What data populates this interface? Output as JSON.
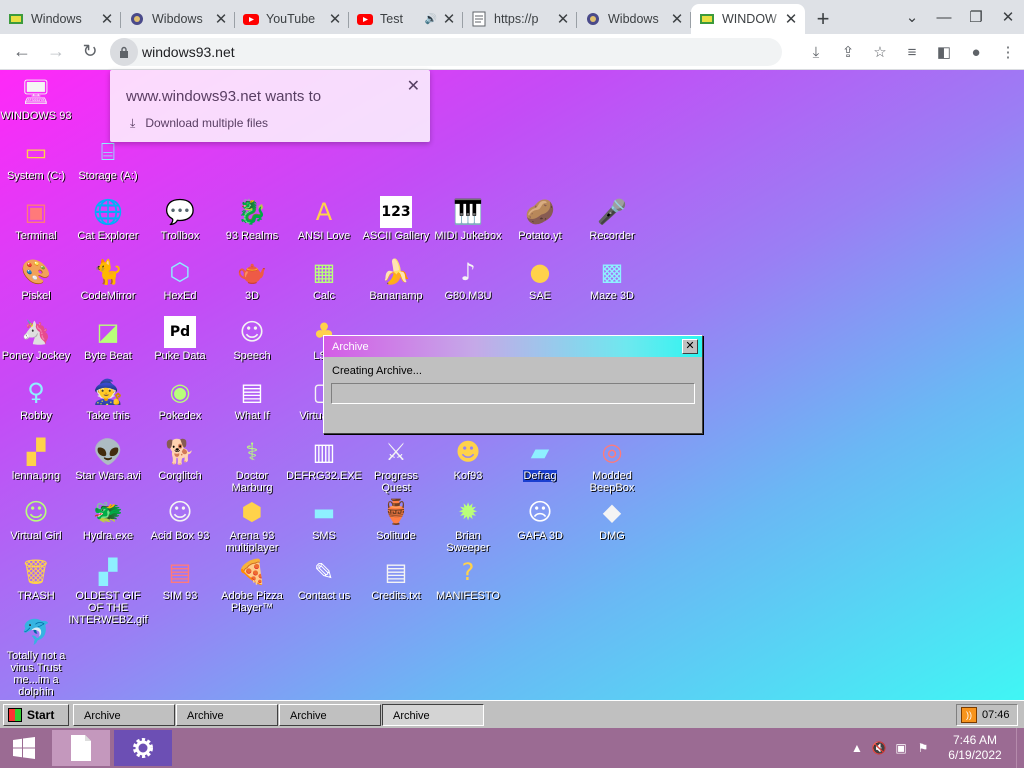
{
  "browser": {
    "tabs": [
      {
        "label": "Windows",
        "icon": "windows93-icon",
        "active": false,
        "audio": false
      },
      {
        "label": "Wibdows",
        "icon": "wibdows-icon",
        "active": false,
        "audio": false
      },
      {
        "label": "YouTube",
        "icon": "youtube-icon",
        "active": false,
        "audio": false
      },
      {
        "label": "Test",
        "icon": "youtube-icon",
        "active": false,
        "audio": true
      },
      {
        "label": "https://p",
        "icon": "page-icon",
        "active": false,
        "audio": false
      },
      {
        "label": "Wibdows",
        "icon": "wibdows-icon",
        "active": false,
        "audio": false
      },
      {
        "label": "WINDOW",
        "icon": "windows93-icon",
        "active": true,
        "audio": false
      }
    ],
    "url": "windows93.net"
  },
  "download_prompt": {
    "title": "www.windows93.net wants to",
    "request": "Download multiple files"
  },
  "desktop": {
    "icons": [
      {
        "label": "WINDOWS 93",
        "glyph": "🖥",
        "col": 0,
        "row": 0
      },
      {
        "label": "System (C:)",
        "glyph": "▭",
        "col": 0,
        "row": 1
      },
      {
        "label": "Storage (A:)",
        "glyph": "⌸",
        "col": 1,
        "row": 1
      },
      {
        "label": "Terminal",
        "glyph": "▣",
        "col": 0,
        "row": 2
      },
      {
        "label": "Cat Explorer",
        "glyph": "🌐",
        "col": 1,
        "row": 2
      },
      {
        "label": "Trollbox",
        "glyph": "💬",
        "col": 2,
        "row": 2
      },
      {
        "label": "93 Realms",
        "glyph": "🐉",
        "col": 3,
        "row": 2
      },
      {
        "label": "ANSI Love",
        "glyph": "A",
        "col": 4,
        "row": 2
      },
      {
        "label": "ASCII Gallery",
        "glyph": "123",
        "col": 5,
        "row": 2
      },
      {
        "label": "MIDI Jukebox",
        "glyph": "🎹",
        "col": 6,
        "row": 2
      },
      {
        "label": "Potato.yt",
        "glyph": "🥔",
        "col": 7,
        "row": 2
      },
      {
        "label": "Recorder",
        "glyph": "🎤",
        "col": 8,
        "row": 2
      },
      {
        "label": "Piskel",
        "glyph": "🎨",
        "col": 0,
        "row": 3
      },
      {
        "label": "CodeMirror",
        "glyph": "🐈",
        "col": 1,
        "row": 3
      },
      {
        "label": "HexEd",
        "glyph": "⬡",
        "col": 2,
        "row": 3
      },
      {
        "label": "3D",
        "glyph": "🫖",
        "col": 3,
        "row": 3
      },
      {
        "label": "Calc",
        "glyph": "▦",
        "col": 4,
        "row": 3
      },
      {
        "label": "Bananamp",
        "glyph": "🍌",
        "col": 5,
        "row": 3
      },
      {
        "label": "G80.M3U",
        "glyph": "♪",
        "col": 6,
        "row": 3
      },
      {
        "label": "SAE",
        "glyph": "●",
        "col": 7,
        "row": 3
      },
      {
        "label": "Maze 3D",
        "glyph": "▩",
        "col": 8,
        "row": 3
      },
      {
        "label": "Poney Jockey",
        "glyph": "🦄",
        "col": 0,
        "row": 4
      },
      {
        "label": "Byte Beat",
        "glyph": "◪",
        "col": 1,
        "row": 4
      },
      {
        "label": "Puke Data",
        "glyph": "Pd",
        "col": 2,
        "row": 4
      },
      {
        "label": "Speech",
        "glyph": "☺",
        "col": 3,
        "row": 4
      },
      {
        "label": "LSD",
        "glyph": "♣",
        "col": 4,
        "row": 4
      },
      {
        "label": "Robby",
        "glyph": "♀",
        "col": 0,
        "row": 5
      },
      {
        "label": "Take this",
        "glyph": "🧙",
        "col": 1,
        "row": 5
      },
      {
        "label": "Pokedex",
        "glyph": "◉",
        "col": 2,
        "row": 5
      },
      {
        "label": "What If",
        "glyph": "▤",
        "col": 3,
        "row": 5
      },
      {
        "label": "Virtual PC",
        "glyph": "▢",
        "col": 4,
        "row": 5
      },
      {
        "label": "lenna.png",
        "glyph": "▞",
        "col": 0,
        "row": 6
      },
      {
        "label": "Star Wars.avi",
        "glyph": "👽",
        "col": 1,
        "row": 6
      },
      {
        "label": "Corglitch",
        "glyph": "🐕",
        "col": 2,
        "row": 6
      },
      {
        "label": "Doctor Marburg",
        "glyph": "⚕",
        "col": 3,
        "row": 6
      },
      {
        "label": "DEFRG32.EXE",
        "glyph": "▥",
        "col": 4,
        "row": 6
      },
      {
        "label": "Progress Quest",
        "glyph": "⚔",
        "col": 5,
        "row": 6
      },
      {
        "label": "Kof93",
        "glyph": "☻",
        "col": 6,
        "row": 6
      },
      {
        "label": "Defrag",
        "glyph": "▰",
        "col": 7,
        "row": 6,
        "selected": true
      },
      {
        "label": "Modded BeepBox",
        "glyph": "◎",
        "col": 8,
        "row": 6
      },
      {
        "label": "Virtual Girl",
        "glyph": "☺",
        "col": 0,
        "row": 7
      },
      {
        "label": "Hydra.exe",
        "glyph": "🐲",
        "col": 1,
        "row": 7
      },
      {
        "label": "Acid Box 93",
        "glyph": "☺",
        "col": 2,
        "row": 7
      },
      {
        "label": "Arena 93 multiplayer",
        "glyph": "⬢",
        "col": 3,
        "row": 7
      },
      {
        "label": "SMS",
        "glyph": "▬",
        "col": 4,
        "row": 7
      },
      {
        "label": "Solitude",
        "glyph": "🏺",
        "col": 5,
        "row": 7
      },
      {
        "label": "Brian Sweeper",
        "glyph": "✹",
        "col": 6,
        "row": 7
      },
      {
        "label": "GAFA 3D",
        "glyph": "☹",
        "col": 7,
        "row": 7
      },
      {
        "label": "DMG",
        "glyph": "◆",
        "col": 8,
        "row": 7
      },
      {
        "label": "TRASH",
        "glyph": "🗑",
        "col": 0,
        "row": 8
      },
      {
        "label": "OLDEST GIF OF THE INTERWEBZ.gif",
        "glyph": "▞",
        "col": 1,
        "row": 8
      },
      {
        "label": "SIM 93",
        "glyph": "▤",
        "col": 2,
        "row": 8
      },
      {
        "label": "Adobe Pizza Player™",
        "glyph": "🍕",
        "col": 3,
        "row": 8
      },
      {
        "label": "Contact us",
        "glyph": "✎",
        "col": 4,
        "row": 8
      },
      {
        "label": "Credits.txt",
        "glyph": "▤",
        "col": 5,
        "row": 8
      },
      {
        "label": "MANIFESTO",
        "glyph": "?",
        "col": 6,
        "row": 8
      },
      {
        "label": "Totally not a virus.Trust me...im a dolphin",
        "glyph": "🐬",
        "col": 0,
        "row": 9
      }
    ]
  },
  "archive_dialog": {
    "title": "Archive",
    "message": "Creating Archive...",
    "progress": 0
  },
  "win93_taskbar": {
    "start_label": "Start",
    "tasks": [
      "Archive",
      "Archive",
      "Archive",
      "Archive"
    ],
    "active_task_index": 3,
    "time": "07:46"
  },
  "windows_taskbar": {
    "time": "7:46 AM",
    "date": "6/19/2022"
  },
  "colors": {
    "dialog_title_gradient": [
      "#d45ce6",
      "#2ef5f0"
    ],
    "selection": "#1a3fd0",
    "win_taskbar": "#9b6b93"
  }
}
